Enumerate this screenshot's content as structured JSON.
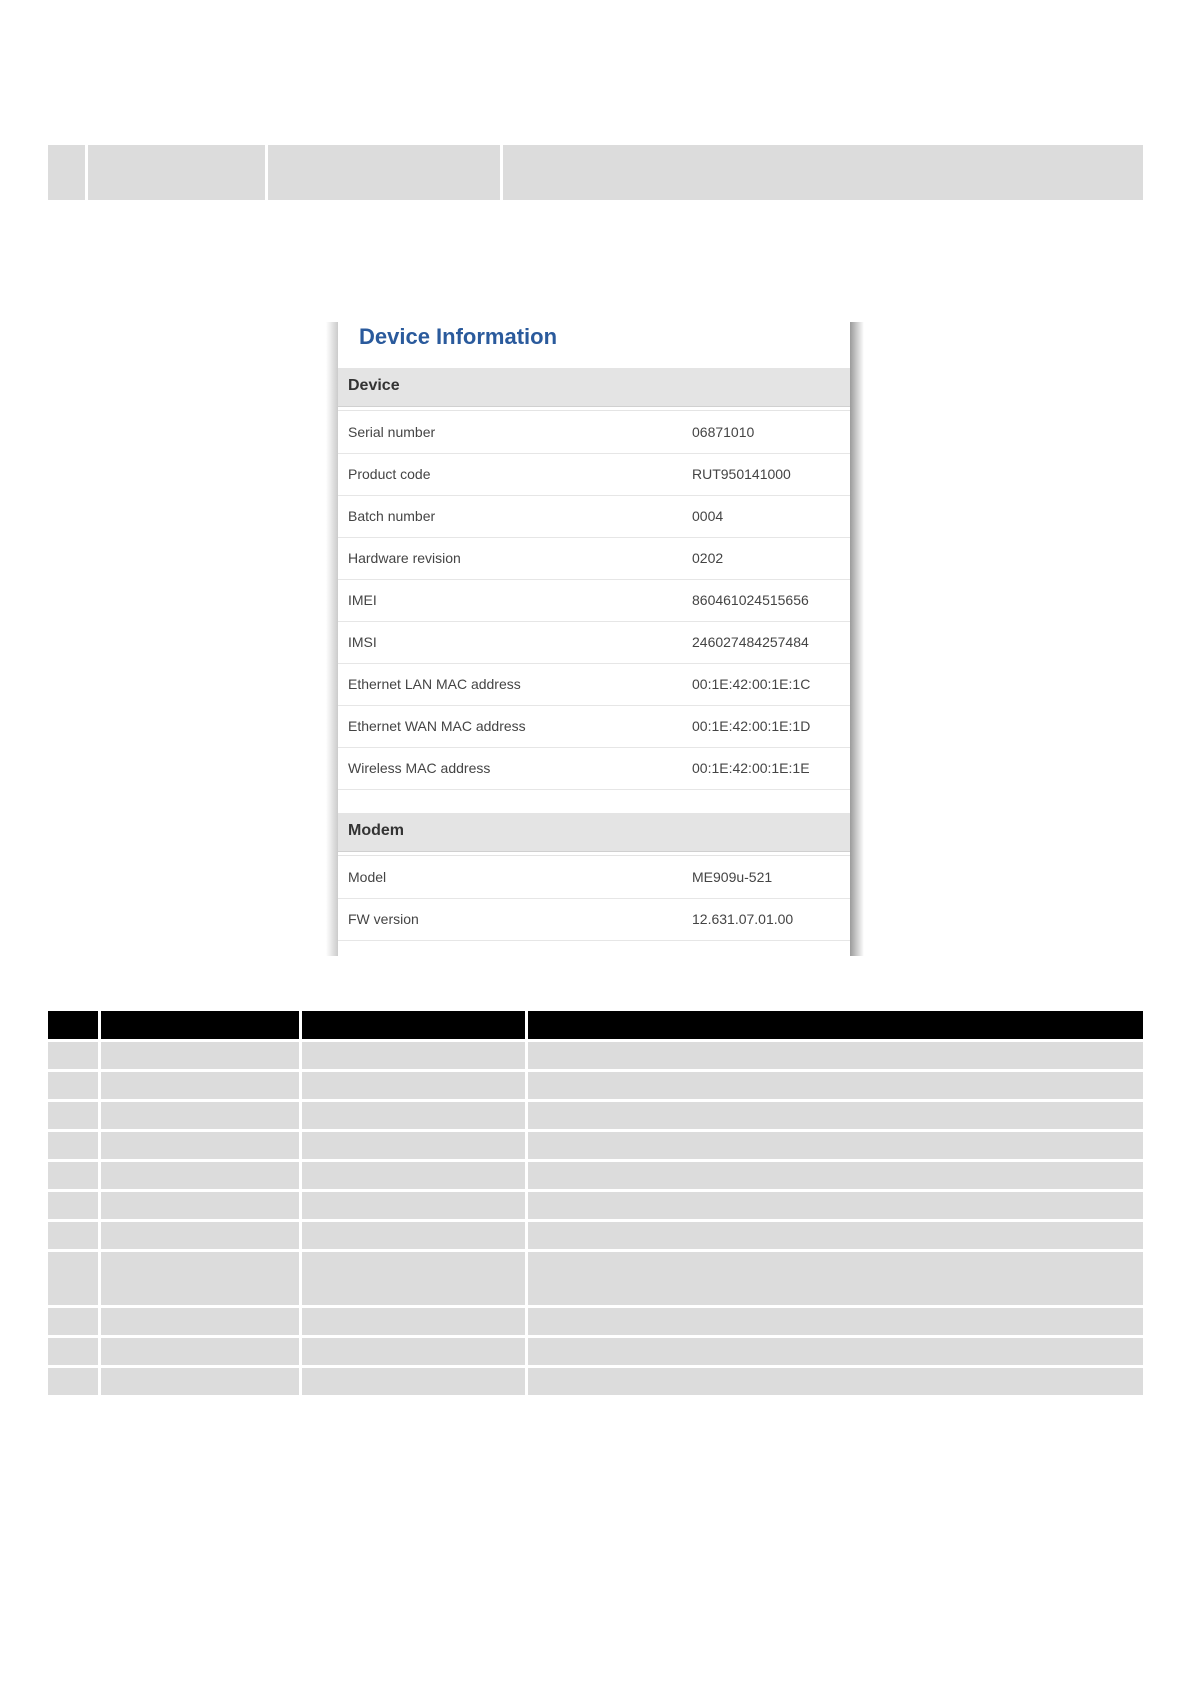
{
  "panel": {
    "title": "Device Information",
    "sections": [
      {
        "heading": "Device",
        "rows": [
          {
            "label": "Serial number",
            "value": "06871010"
          },
          {
            "label": "Product code",
            "value": "RUT950141000"
          },
          {
            "label": "Batch number",
            "value": "0004"
          },
          {
            "label": "Hardware revision",
            "value": "0202"
          },
          {
            "label": "IMEI",
            "value": "860461024515656"
          },
          {
            "label": "IMSI",
            "value": "246027484257484"
          },
          {
            "label": "Ethernet LAN MAC address",
            "value": "00:1E:42:00:1E:1C"
          },
          {
            "label": "Ethernet WAN MAC address",
            "value": "00:1E:42:00:1E:1D"
          },
          {
            "label": "Wireless MAC address",
            "value": "00:1E:42:00:1E:1E"
          }
        ]
      },
      {
        "heading": "Modem",
        "rows": [
          {
            "label": "Model",
            "value": "ME909u-521"
          },
          {
            "label": "FW version",
            "value": "12.631.07.01.00"
          }
        ]
      }
    ]
  },
  "colors": {
    "title": "#2a5a9c",
    "section_bg": "#e4e4e4",
    "table_cell_bg": "#dcdcdc",
    "table_header_bg": "#000000"
  }
}
